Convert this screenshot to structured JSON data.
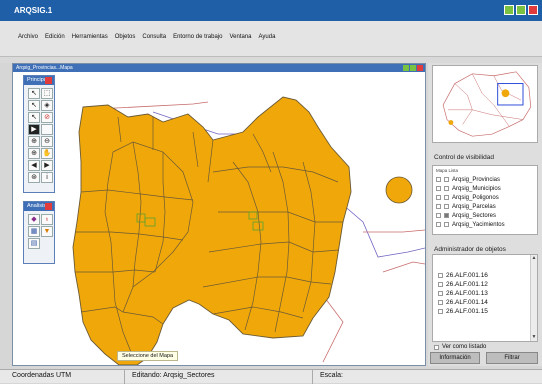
{
  "app_title": "ARQSIG.1",
  "menu": [
    "Archivo",
    "Edición",
    "Herramientas",
    "Objetos",
    "Consulta",
    "Entorno de trabajo",
    "Ventana",
    "Ayuda"
  ],
  "map_window": {
    "title": "Arqsig_Provincias...Mapa"
  },
  "panels": {
    "principal": "Principal",
    "analisis": "Analisis"
  },
  "tooltip": "Seleccione del Mapa",
  "visibility": {
    "title": "Control de visibilidad",
    "header": "Mapa Lista",
    "layers": [
      "Arqsig_Provincias",
      "Arqsig_Municipios",
      "Arqsig_Poligonos",
      "Arqsig_Parcelas",
      "Arqsig_Sectores",
      "Arqsig_Yacimientos"
    ]
  },
  "objects": {
    "title": "Administrador de objetos",
    "items": [
      "26.ALF.001.16",
      "26.ALF.001.12",
      "26.ALF.001.13",
      "26.ALF.001.14",
      "26.ALF.001.15"
    ],
    "ver_como_listado": "Ver como listado",
    "btn_info": "Información",
    "btn_filter": "Filtrar"
  },
  "status": {
    "coords": "Coordenadas UTM",
    "editing": "Editando: Arqsig_Sectores",
    "scale": "Escala:"
  },
  "colors": {
    "title_blue": "#1f5fa8",
    "parcel_fill": "#f0a70a",
    "parcel_line": "#6b5a35"
  }
}
